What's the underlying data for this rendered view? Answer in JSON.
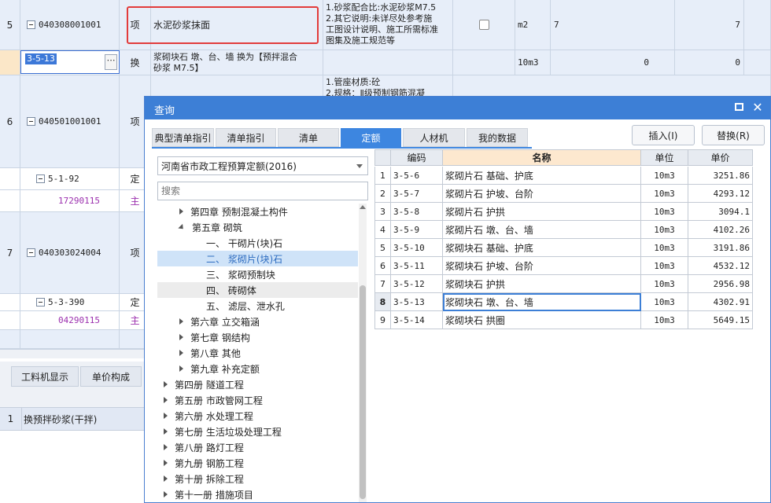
{
  "rows": [
    {
      "num": "5",
      "code": "040308001001",
      "type": "项",
      "name": "水泥砂浆抹面",
      "features": [
        "1.砂浆配合比:水泥砂浆M7.5",
        "2.其它说明:未详尽处参考施",
        "工图设计说明、施工所需标准",
        "图集及施工规范等"
      ],
      "unit": "m2",
      "qty": "7",
      "amount": "7"
    },
    {
      "code": "3-5-13",
      "type": "换",
      "name_lines": [
        "浆砌块石 墩、台、墙  换为【预拌混合",
        "砂浆 M7.5】"
      ],
      "unit": "10m3",
      "qty": "0",
      "amount": "0"
    },
    {
      "num": "6",
      "code": "040501001001",
      "type": "项",
      "features": [
        "1.管座材质:砼",
        "2.规格：Ⅱ级预制钢筋混凝"
      ]
    },
    {
      "code": "5-1-92",
      "type": "定"
    },
    {
      "code": "17290115",
      "type": "主"
    },
    {
      "num": "7",
      "code": "040303024004",
      "type": "项"
    },
    {
      "code": "5-3-390",
      "type": "定"
    },
    {
      "code": "04290115",
      "type": "主"
    }
  ],
  "bottom_panel": {
    "tabs": [
      "工料机显示",
      "单价构成"
    ],
    "row": {
      "num": "1",
      "text": "换预拌砂浆(干拌)"
    }
  },
  "dialog": {
    "title": "查询",
    "tabs": [
      "典型清单指引",
      "清单指引",
      "清单",
      "定额",
      "人材机",
      "我的数据"
    ],
    "insert_label": "插入(I)",
    "replace_label": "替换(R)",
    "quota_lib": "河南省市政工程预算定额(2016)",
    "search_placeholder": "搜索",
    "tree": [
      {
        "label": "第四章 预制混凝土构件",
        "indent": 1,
        "caret": "right"
      },
      {
        "label": "第五章 砌筑",
        "indent": 1,
        "caret": "down"
      },
      {
        "label": "一、 干砌片(块)石",
        "indent": 2
      },
      {
        "label": "二、 浆砌片(块)石",
        "indent": 2,
        "selected": true
      },
      {
        "label": "三、 浆砌预制块",
        "indent": 2
      },
      {
        "label": "四、 砖砌体",
        "indent": 2,
        "hover": true
      },
      {
        "label": "五、 滤层、泄水孔",
        "indent": 2
      },
      {
        "label": "第六章 立交箱涵",
        "indent": 1,
        "caret": "right"
      },
      {
        "label": "第七章 钢结构",
        "indent": 1,
        "caret": "right"
      },
      {
        "label": "第八章 其他",
        "indent": 1,
        "caret": "right"
      },
      {
        "label": "第九章 补充定额",
        "indent": 1,
        "caret": "right"
      },
      {
        "label": "第四册 隧道工程",
        "indent": 0,
        "caret": "right"
      },
      {
        "label": "第五册 市政管网工程",
        "indent": 0,
        "caret": "right"
      },
      {
        "label": "第六册 水处理工程",
        "indent": 0,
        "caret": "right"
      },
      {
        "label": "第七册 生活垃圾处理工程",
        "indent": 0,
        "caret": "right"
      },
      {
        "label": "第八册 路灯工程",
        "indent": 0,
        "caret": "right"
      },
      {
        "label": "第九册 钢筋工程",
        "indent": 0,
        "caret": "right"
      },
      {
        "label": "第十册 拆除工程",
        "indent": 0,
        "caret": "right"
      },
      {
        "label": "第十一册 措施项目",
        "indent": 0,
        "caret": "right"
      }
    ],
    "grid": {
      "headers": [
        "编码",
        "名称",
        "单位",
        "单价"
      ],
      "rows": [
        {
          "idx": "1",
          "code": "3-5-6",
          "name": "浆砌片石 基础、护底",
          "unit": "10m3",
          "price": "3251.86"
        },
        {
          "idx": "2",
          "code": "3-5-7",
          "name": "浆砌片石 护坡、台阶",
          "unit": "10m3",
          "price": "4293.12"
        },
        {
          "idx": "3",
          "code": "3-5-8",
          "name": "浆砌片石 护拱",
          "unit": "10m3",
          "price": "3094.1"
        },
        {
          "idx": "4",
          "code": "3-5-9",
          "name": "浆砌片石 墩、台、墙",
          "unit": "10m3",
          "price": "4102.26"
        },
        {
          "idx": "5",
          "code": "3-5-10",
          "name": "浆砌块石 基础、护底",
          "unit": "10m3",
          "price": "3191.86"
        },
        {
          "idx": "6",
          "code": "3-5-11",
          "name": "浆砌块石 护坡、台阶",
          "unit": "10m3",
          "price": "4532.12"
        },
        {
          "idx": "7",
          "code": "3-5-12",
          "name": "浆砌块石 护拱",
          "unit": "10m3",
          "price": "2956.98"
        },
        {
          "idx": "8",
          "code": "3-5-13",
          "name": "浆砌块石 墩、台、墙",
          "unit": "10m3",
          "price": "4302.91",
          "selected": true
        },
        {
          "idx": "9",
          "code": "3-5-14",
          "name": "浆砌块石 拱圈",
          "unit": "10m3",
          "price": "5649.15"
        }
      ]
    }
  }
}
